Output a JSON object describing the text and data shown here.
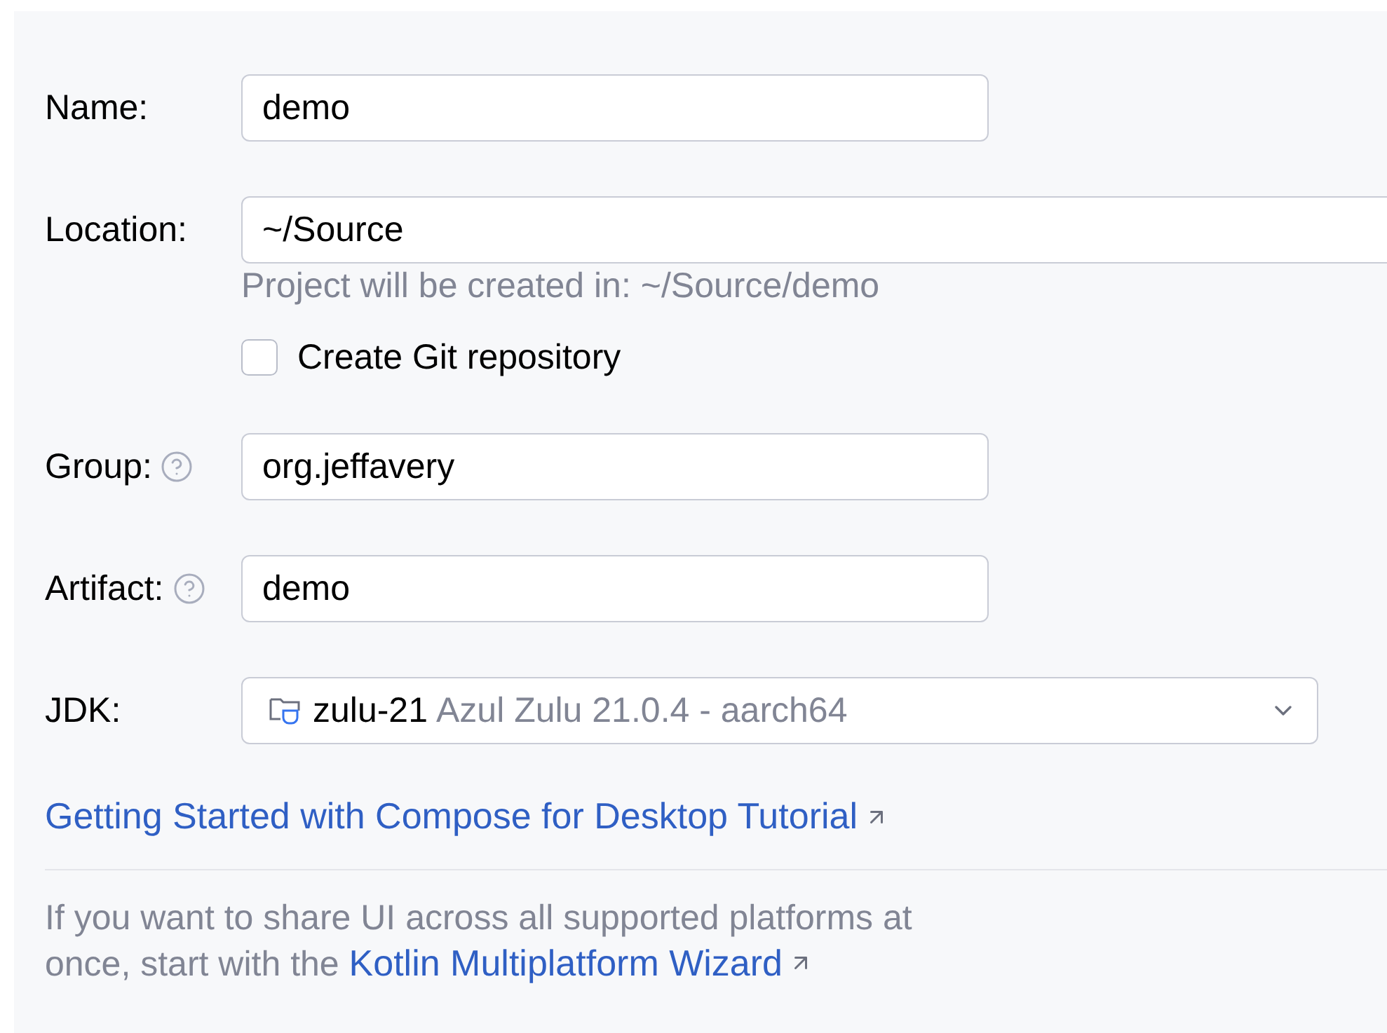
{
  "fields": [
    {
      "kind": "text",
      "label": "Name:",
      "help": false,
      "value": "demo",
      "wide": false
    },
    {
      "kind": "text",
      "label": "Location:",
      "help": false,
      "value": "~/Source",
      "hint": "Project will be created in: ~/Source/demo",
      "wide": true
    },
    {
      "kind": "checkbox",
      "label": "Create Git repository",
      "checked": false
    },
    {
      "kind": "text",
      "label": "Group:",
      "help": true,
      "value": "org.jeffavery",
      "wide": false
    },
    {
      "kind": "text",
      "label": "Artifact:",
      "help": true,
      "value": "demo",
      "wide": false
    },
    {
      "kind": "select",
      "label": "JDK:",
      "value": "zulu-21",
      "detail": "Azul Zulu 21.0.4 - aarch64"
    }
  ],
  "tutorial_link": "Getting Started with Compose for Desktop Tutorial",
  "note": {
    "text": "If you want to share UI across all supported platforms at once, start with the",
    "link": "Kotlin Multiplatform Wizard"
  }
}
